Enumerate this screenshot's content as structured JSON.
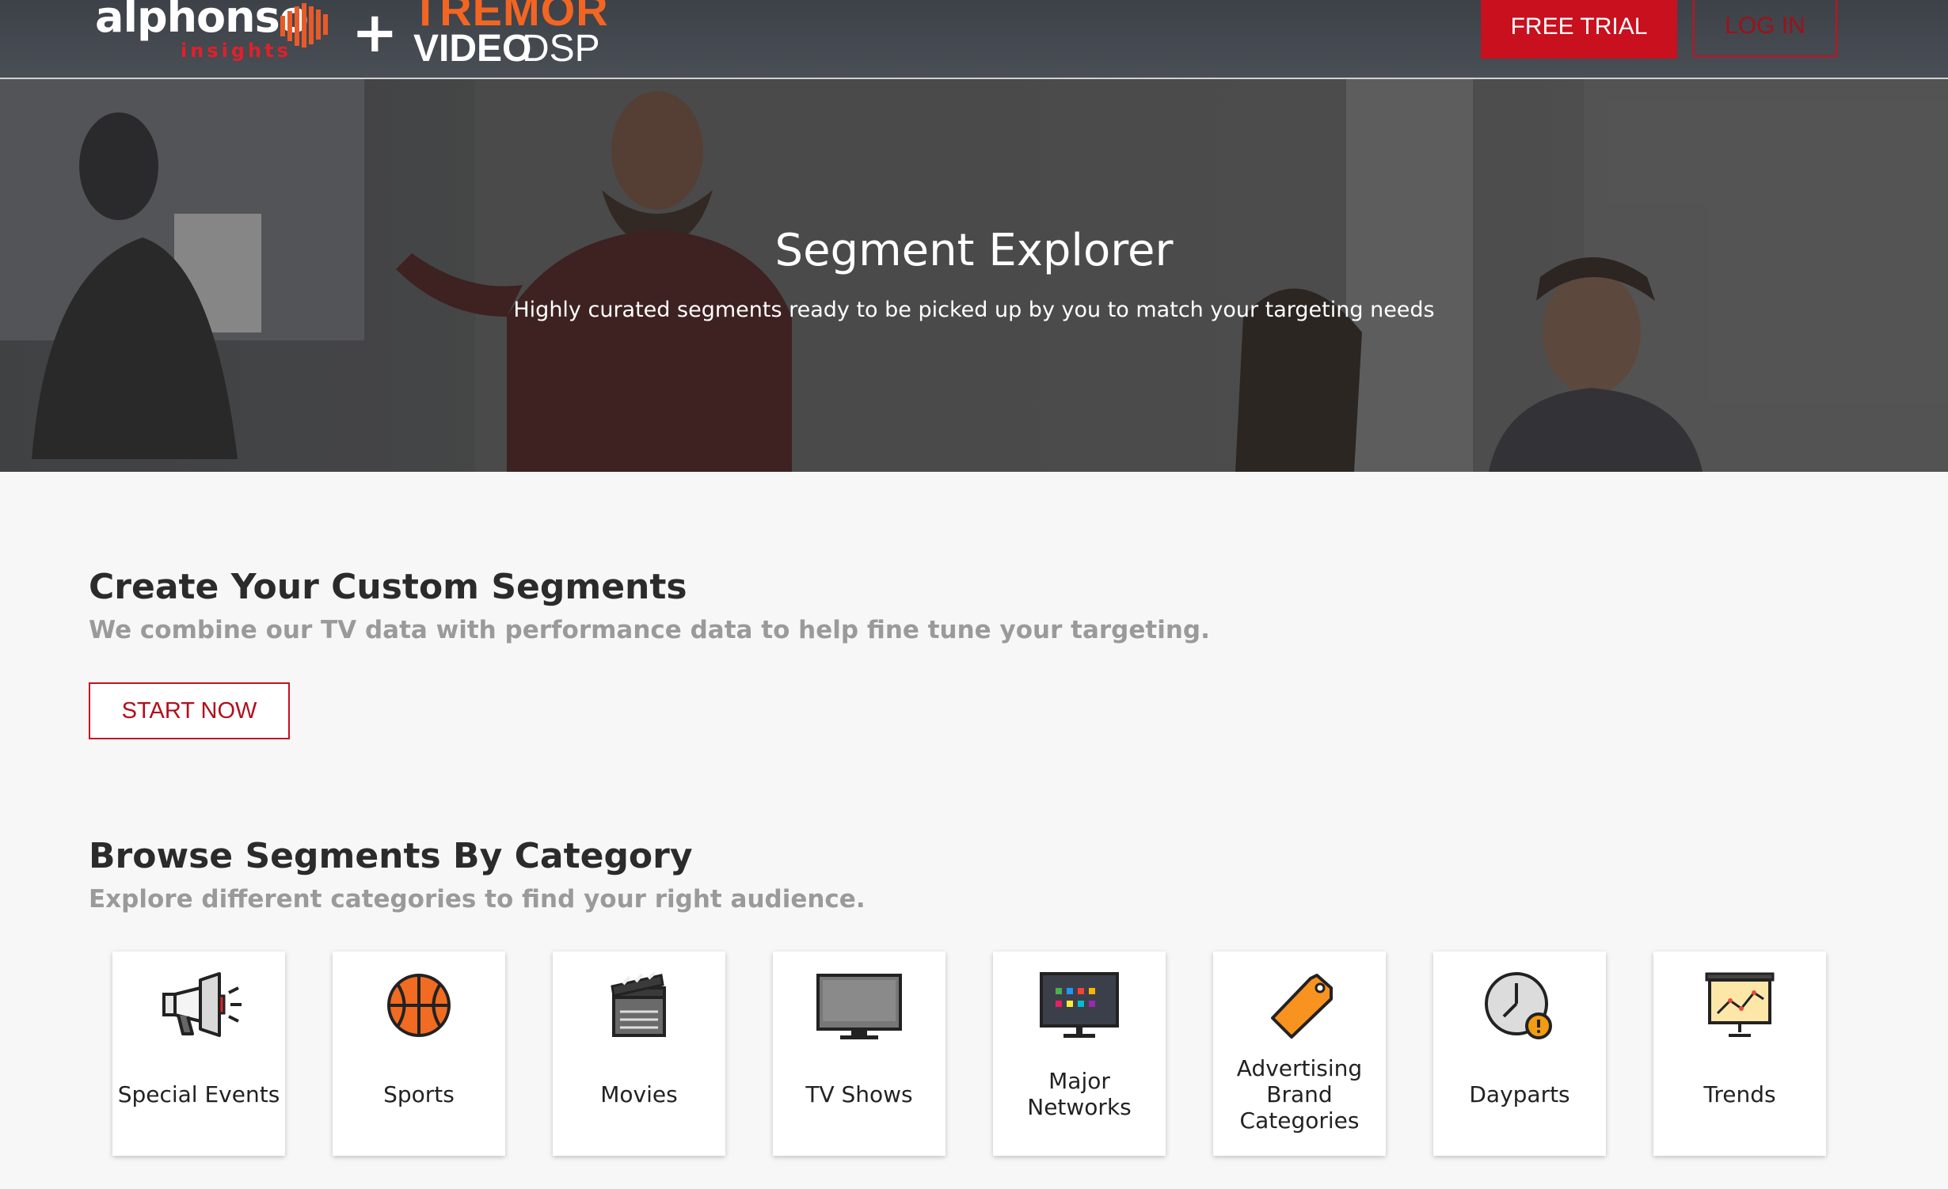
{
  "header": {
    "logo_alphonso": "alphonso",
    "logo_insights": "insights",
    "logo_plus": "+",
    "logo_tremor": "TREMOR",
    "logo_video": "VIDEO",
    "logo_dsp": "DSP",
    "free_trial_label": "FREE TRIAL",
    "login_label": "LOG IN"
  },
  "hero": {
    "title": "Segment Explorer",
    "subtitle": "Highly curated segments ready to be picked up by you to match your targeting needs"
  },
  "custom": {
    "title": "Create Your Custom Segments",
    "subtitle": "We combine our TV data with performance data to help fine tune your targeting.",
    "button_label": "START NOW"
  },
  "browse": {
    "title": "Browse Segments By Category",
    "subtitle": "Explore different categories to find your right audience.",
    "categories": [
      {
        "label": "Special Events",
        "icon": "megaphone-icon"
      },
      {
        "label": "Sports",
        "icon": "basketball-icon"
      },
      {
        "label": "Movies",
        "icon": "clapperboard-icon"
      },
      {
        "label": "TV Shows",
        "icon": "tv-icon"
      },
      {
        "label": "Major Networks",
        "icon": "tv-channels-icon"
      },
      {
        "label": "Advertising Brand Categories",
        "icon": "price-tag-icon"
      },
      {
        "label": "Dayparts",
        "icon": "clock-icon"
      },
      {
        "label": "Trends",
        "icon": "trend-chart-icon"
      }
    ]
  },
  "colors": {
    "accent_red": "#c8101e",
    "tremor_orange": "#f26522",
    "header_bg": "#42464d"
  }
}
